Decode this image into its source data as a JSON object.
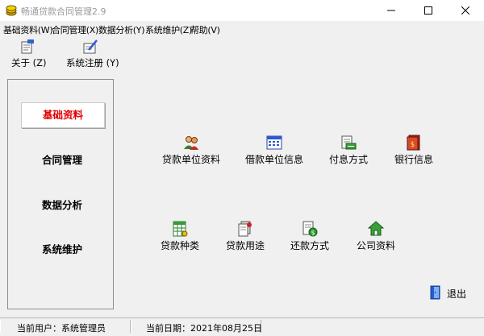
{
  "window": {
    "title": "畅通贷款合同管理2.9",
    "icons": {
      "app": "coin-stack-icon",
      "minimize": "minimize-icon",
      "maximize": "maximize-icon",
      "close": "close-icon"
    }
  },
  "menu": [
    {
      "label": "基础资料(W)"
    },
    {
      "label": "合同管理(X)"
    },
    {
      "label": "数据分析(Y)"
    },
    {
      "label": "系统维护(Z)"
    },
    {
      "label": "帮助(V)"
    }
  ],
  "toolbar": [
    {
      "label": "关于 (Z)",
      "icon": "about-icon"
    },
    {
      "label": "系统注册 (Y)",
      "icon": "register-icon"
    }
  ],
  "sidebar": {
    "items": [
      {
        "label": "基础资料",
        "active": true
      },
      {
        "label": "合同管理",
        "active": false
      },
      {
        "label": "数据分析",
        "active": false
      },
      {
        "label": "系统维护",
        "active": false
      }
    ],
    "active_color": "#e00000"
  },
  "functions": [
    {
      "label": "贷款单位资料",
      "icon": "users-icon"
    },
    {
      "label": "借款单位信息",
      "icon": "calendar-grid-icon"
    },
    {
      "label": "付息方式",
      "icon": "payment-icon"
    },
    {
      "label": "银行信息",
      "icon": "bank-book-icon"
    },
    {
      "label": "贷款种类",
      "icon": "spreadsheet-icon"
    },
    {
      "label": "贷款用途",
      "icon": "documents-icon"
    },
    {
      "label": "还款方式",
      "icon": "refund-icon"
    },
    {
      "label": "公司资料",
      "icon": "home-icon"
    }
  ],
  "exit": {
    "label": "退出",
    "icon": "exit-door-icon"
  },
  "status": {
    "user": "当前用户：系统管理员",
    "date": "当前日期：2021年08月25日"
  }
}
